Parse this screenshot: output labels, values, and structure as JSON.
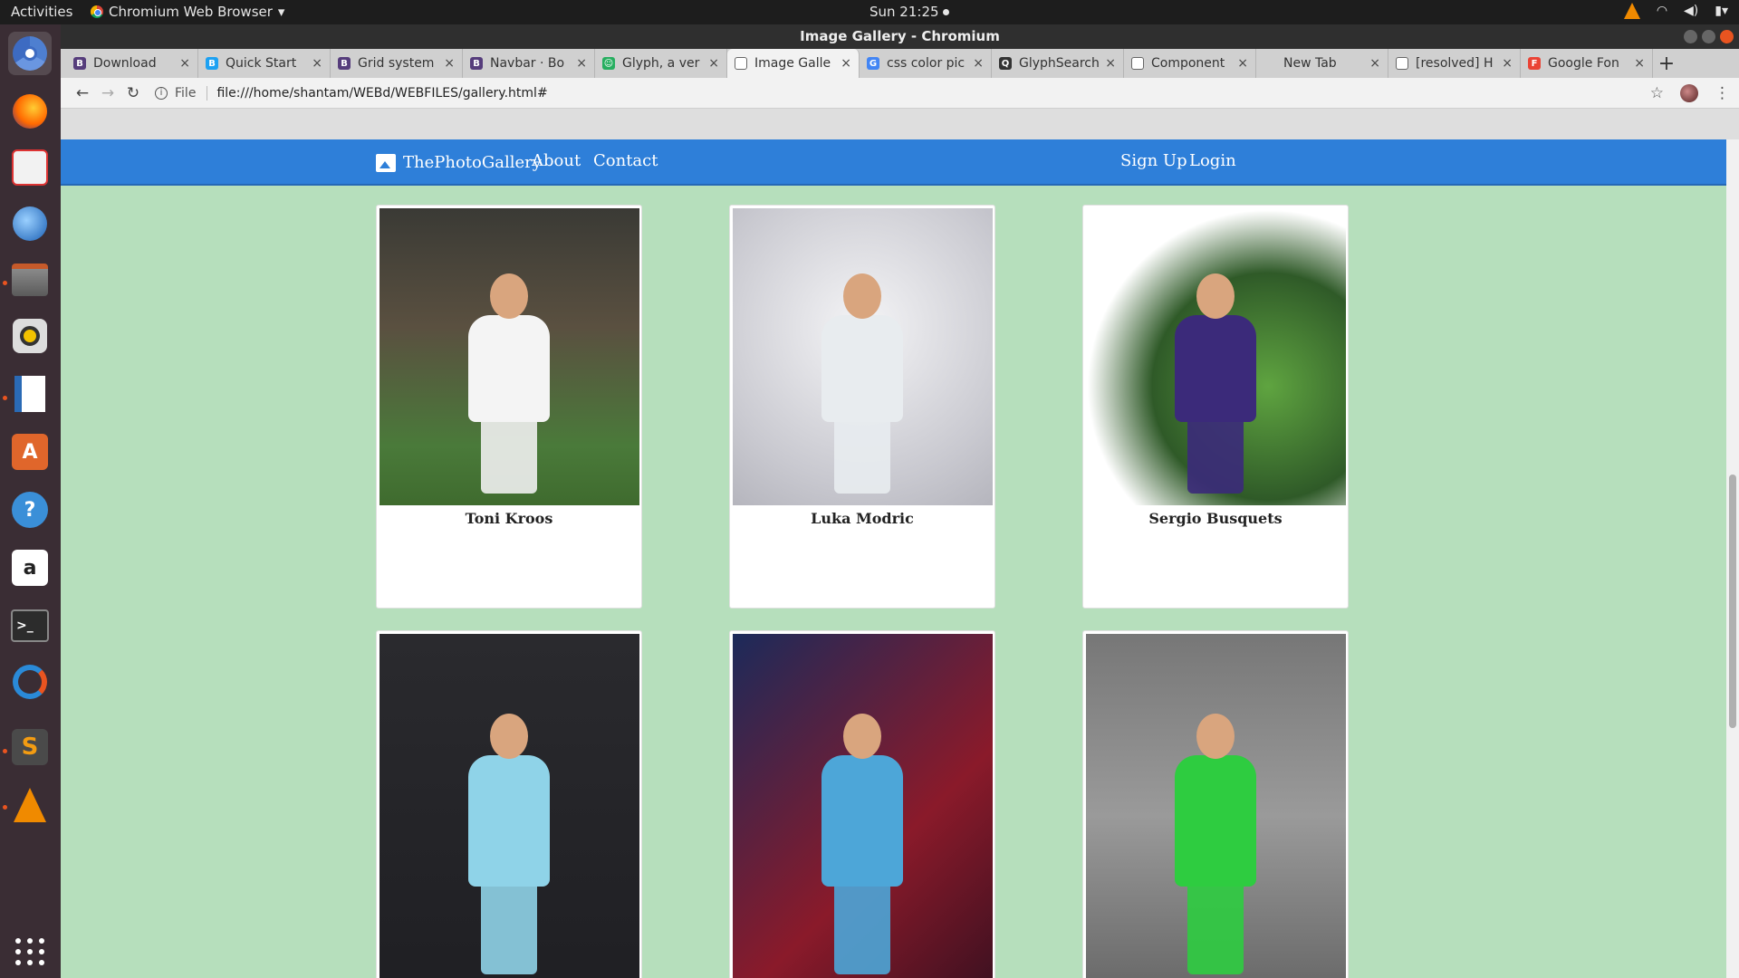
{
  "os": {
    "activities": "Activities",
    "app_menu": "Chromium Web Browser",
    "clock": "Sun 21:25"
  },
  "window": {
    "title": "Image Gallery - Chromium"
  },
  "tabs": [
    {
      "label": "Download",
      "fav": "B",
      "color": "#563d7c"
    },
    {
      "label": "Quick Start",
      "fav": "B",
      "color": "#1da1f2"
    },
    {
      "label": "Grid system",
      "fav": "B",
      "color": "#563d7c"
    },
    {
      "label": "Navbar · Bo",
      "fav": "B",
      "color": "#563d7c"
    },
    {
      "label": "Glyph, a ver",
      "fav": "☺",
      "color": "#27ae60"
    },
    {
      "label": "Image Galle",
      "fav": "",
      "color": "#ffffff"
    },
    {
      "label": "css color pic",
      "fav": "G",
      "color": "#4285f4"
    },
    {
      "label": "GlyphSearch",
      "fav": "Q",
      "color": "#333333"
    },
    {
      "label": "Component",
      "fav": "",
      "color": "#ffffff"
    },
    {
      "label": "New Tab",
      "fav": "",
      "color": "transparent"
    },
    {
      "label": "[resolved] H",
      "fav": "",
      "color": "#ffffff"
    },
    {
      "label": "Google Fon",
      "fav": "F",
      "color": "#ea4335"
    }
  ],
  "active_tab_index": 5,
  "address": {
    "scheme": "File",
    "url": "file:///home/shantam/WEBd/WEBFILES/gallery.html#"
  },
  "site": {
    "brand": "ThePhotoGallery",
    "nav": {
      "about": "About",
      "contact": "Contact",
      "signup": "Sign Up",
      "login": "Login"
    },
    "accent": "#2e7fd9",
    "background": "#b6dfbc"
  },
  "gallery": [
    {
      "name": "Toni Kroos",
      "bg": "linear-gradient(180deg,#3a3a35,#5a5040 40%,#4a7a3a 80%,#3f6b2e)",
      "shirt": "#f4f4f4",
      "shorts": "#f0f0f0"
    },
    {
      "name": "Luka Modric",
      "bg": "radial-gradient(circle at 50% 40%,#f4f4f6,#c9c9d0 70%,#b5b5bd)",
      "shirt": "#e8ecef",
      "shorts": "#e8ecef"
    },
    {
      "name": "Sergio Busquets",
      "bg": "radial-gradient(ellipse at 70% 60%,#5fa440,#2f5a28 45%,#ffffff 70%)",
      "shirt": "#3b2a7a",
      "shorts": "#3b2a7a"
    },
    {
      "name": "",
      "bg": "linear-gradient(180deg,#2a2a2e,#1f1f23)",
      "shirt": "#8fd3e8",
      "shorts": "#8fd3e8"
    },
    {
      "name": "",
      "bg": "linear-gradient(135deg,#1c2a5a,#8a1a2a 60%,#3a1020)",
      "shirt": "#4da6d8",
      "shorts": "#4da6d8"
    },
    {
      "name": "",
      "bg": "linear-gradient(180deg,#777,#9a9a9a 50%,#666)",
      "shirt": "#2ecc40",
      "shorts": "#2ecc40"
    }
  ]
}
